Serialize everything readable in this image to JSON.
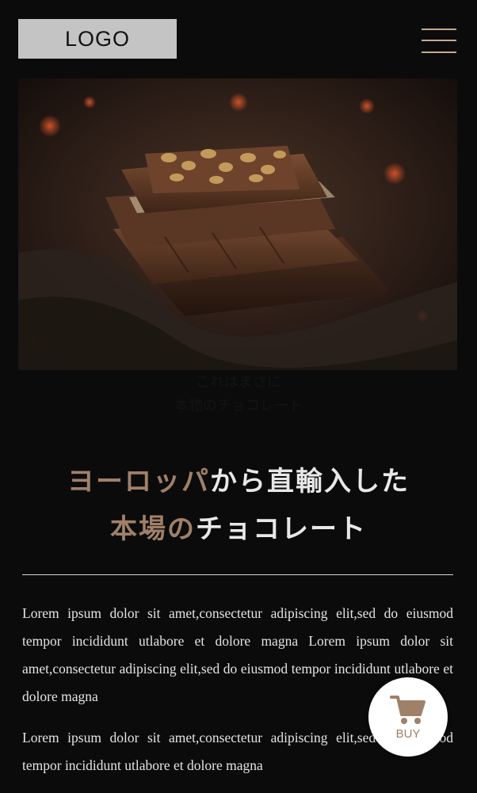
{
  "header": {
    "logo_text": "LOGO",
    "menu_icon": "hamburger-menu-icon"
  },
  "hero": {
    "image": "chocolate-bars-photo"
  },
  "caption": {
    "line1": "これはまさに",
    "line2": "本物のチョコレート"
  },
  "headline": {
    "line1_accent": "ヨーロッパ",
    "line1_rest": "から直輸入した",
    "line2_accent": "本場の",
    "line2_rest": "チョコレート"
  },
  "body": {
    "paragraphs": [
      "Lorem ipsum dolor sit amet,consectetur adipiscing elit,sed do eiusmod tempor incididunt utlabore et dolore magna Lorem ipsum dolor sit amet,consectetur adipiscing elit,sed do eiusmod tempor incididunt utlabore et dolore magna",
      "Lorem ipsum dolor sit amet,consectetur adipiscing elit,sed do eiusmod tempor incididunt utlabore et dolore magna"
    ]
  },
  "buy_button": {
    "label": "BUY",
    "icon": "shopping-cart-icon"
  },
  "colors": {
    "background": "#0b0b0b",
    "accent": "#a08068",
    "menu_lines": "#c6a98b",
    "logo_bg": "#c4c4c4"
  }
}
